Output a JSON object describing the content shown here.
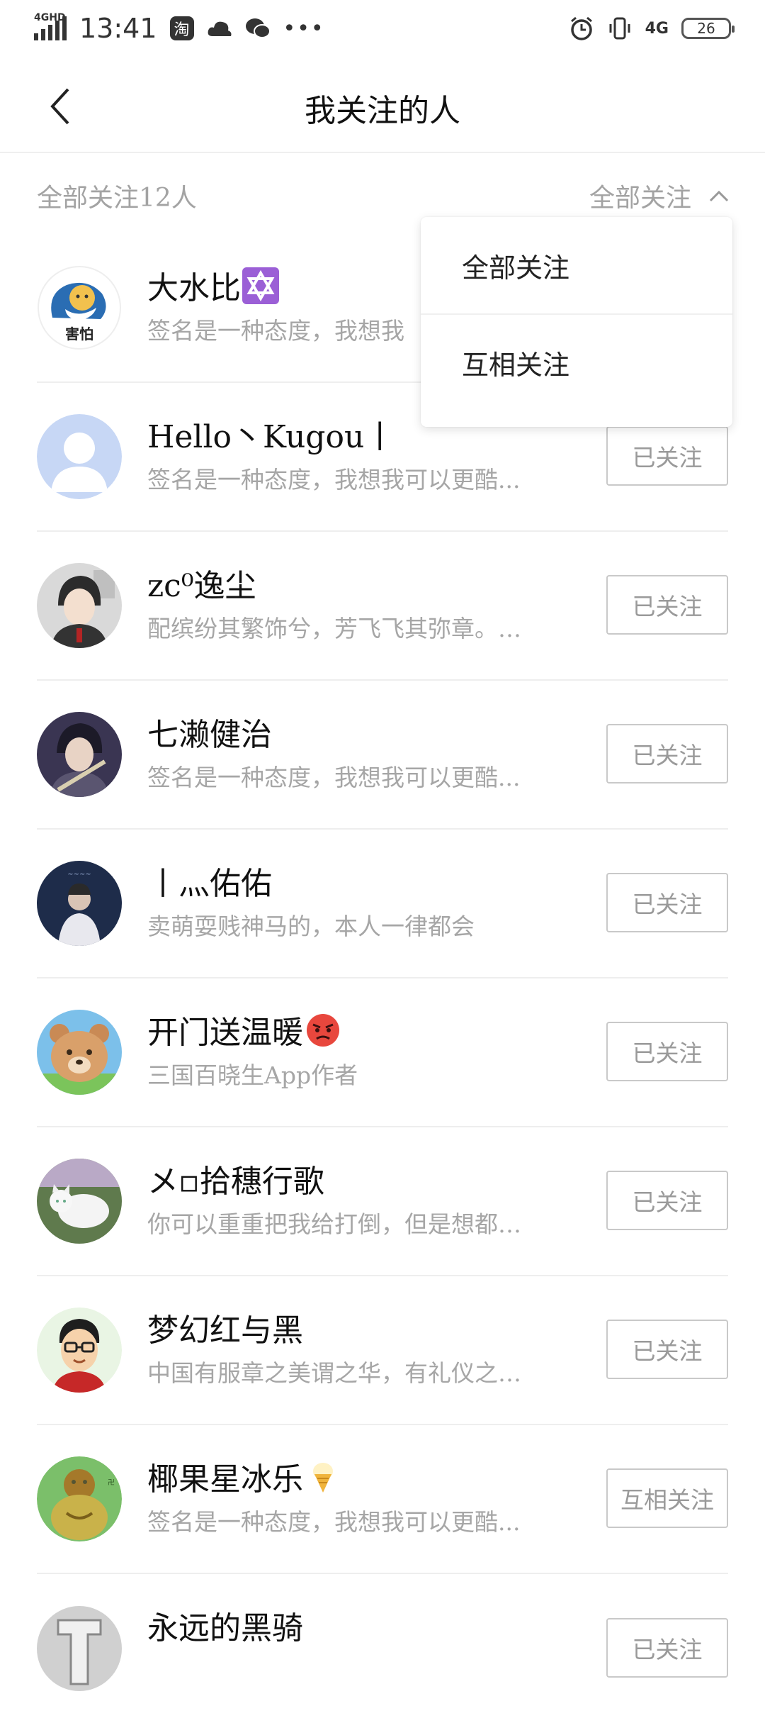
{
  "status_bar": {
    "network": "4GHD",
    "time": "13:41",
    "app_icon_label": "淘",
    "more": "•••",
    "network_right": "4G",
    "battery": "26"
  },
  "header": {
    "title": "我关注的人"
  },
  "filter": {
    "count_label": "全部关注12人",
    "selected": "全部关注"
  },
  "dropdown": {
    "options": [
      "全部关注",
      "互相关注"
    ]
  },
  "users": [
    {
      "name": "大水比",
      "signature": "签名是一种态度，我想我",
      "button": "",
      "avatar": "shy-bird",
      "emoji": "star-of-david"
    },
    {
      "name": "Hello丶Kugou丨",
      "signature": "签名是一种态度，我想我可以更酷...",
      "button": "已关注",
      "avatar": "default-user"
    },
    {
      "name": "zc⁰逸尘",
      "signature": "配缤纷其繁饰兮，芳飞飞其弥章。…",
      "button": "已关注",
      "avatar": "anime-boy"
    },
    {
      "name": "七濑健治",
      "signature": "签名是一种态度，我想我可以更酷...",
      "button": "已关注",
      "avatar": "anime-guitarist"
    },
    {
      "name": "丨灬佑佑",
      "signature": "卖萌耍贱神马的，本人一律都会",
      "button": "已关注",
      "avatar": "portrait-dark"
    },
    {
      "name": "开门送温暖",
      "signature": "三国百晓生App作者",
      "button": "已关注",
      "avatar": "bear",
      "emoji": "angry-face"
    },
    {
      "name": "メ▫拾穗行歌",
      "signature": "你可以重重把我给打倒，但是想都…",
      "button": "已关注",
      "avatar": "white-cat"
    },
    {
      "name": "梦幻红与黑",
      "signature": "中国有服章之美谓之华，有礼仪之…",
      "button": "已关注",
      "avatar": "cartoon-glasses"
    },
    {
      "name": "椰果星冰乐",
      "signature": "签名是一种态度，我想我可以更酷...",
      "button": "互相关注",
      "avatar": "frog-buddha",
      "emoji": "ice-cream"
    },
    {
      "name": "永远的黑骑",
      "signature": "",
      "button": "已关注",
      "avatar": "knight"
    }
  ],
  "colors": {
    "secondary_text": "#a6a6a6",
    "button_border": "#c9c9c9",
    "divider": "#eeeeee"
  }
}
